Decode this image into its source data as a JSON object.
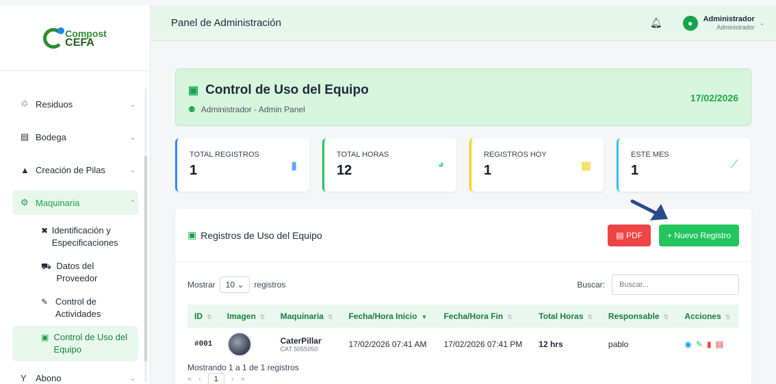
{
  "brand": {
    "line1": "Compost",
    "line2": "CEFA"
  },
  "header": {
    "title": "Panel de Administración",
    "user_name": "Administrador",
    "user_role": "Administrador"
  },
  "sidebar": {
    "items": [
      {
        "label": "Residuos",
        "icon": "recycle-icon"
      },
      {
        "label": "Bodega",
        "icon": "warehouse-icon"
      },
      {
        "label": "Creación de Pilas",
        "icon": "triangle-icon"
      },
      {
        "label": "Maquinaria",
        "icon": "gears-icon"
      },
      {
        "label": "Abono",
        "icon": "seedling-icon"
      }
    ],
    "subitems": [
      {
        "label": "Identificación y Especificaciones",
        "icon": "tools-icon"
      },
      {
        "label": "Datos del Proveedor",
        "icon": "truck-icon"
      },
      {
        "label": "Control de Actividades",
        "icon": "wrench-icon"
      },
      {
        "label": "Control de Uso del Equipo",
        "icon": "clipboard-check-icon"
      }
    ]
  },
  "page": {
    "title": "Control de Uso del Equipo",
    "subtitle": "Administrador - Admin Panel",
    "date": "17/02/2026"
  },
  "stats": [
    {
      "label": "TOTAL REGISTROS",
      "value": "1",
      "icon": "clipboard-icon",
      "color": "#3b82f6"
    },
    {
      "label": "TOTAL HORAS",
      "value": "12",
      "icon": "clock-icon",
      "color": "#22c55e"
    },
    {
      "label": "REGISTROS HOY",
      "value": "1",
      "icon": "calendar-icon",
      "color": "#facc15"
    },
    {
      "label": "ESTE MES",
      "value": "1",
      "icon": "chart-line-icon",
      "color": "#38bdf8"
    }
  ],
  "records": {
    "title": "Registros de Uso del Equipo",
    "pdf_label": "PDF",
    "new_label": "+ Nuevo Registro",
    "show_label": "Mostrar",
    "page_length": "10",
    "records_label": "registros",
    "search_label": "Buscar:",
    "search_placeholder": "Buscar...",
    "columns": [
      "ID",
      "Imagen",
      "Maquinaria",
      "Fecha/Hora Inicio",
      "Fecha/Hora Fin",
      "Total Horas",
      "Responsable",
      "Acciones"
    ],
    "rows": [
      {
        "id": "#001",
        "machine": "CaterPillar",
        "model": "CAT 5055050",
        "start": "17/02/2026 07:41 AM",
        "end": "17/02/2026 07:41 PM",
        "hours": "12 hrs",
        "responsible": "pablo"
      }
    ],
    "info": "Mostrando 1 a 1 de 1 registros",
    "page_number": "1"
  }
}
